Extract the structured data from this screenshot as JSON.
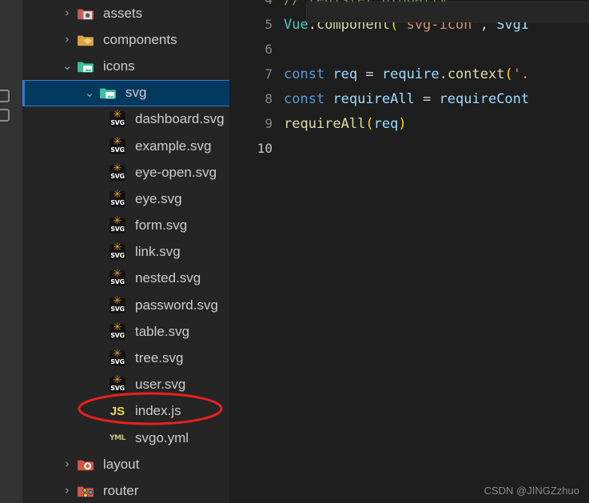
{
  "activity_bar": {
    "icons": [
      "chevron-right-icon",
      "square-outline-icon",
      "square-outline-icon"
    ]
  },
  "explorer": {
    "items": [
      {
        "label": "assets",
        "type": "folder",
        "icon": "folder-assets-icon",
        "twisty": "›",
        "indent": 1,
        "selected": false
      },
      {
        "label": "components",
        "type": "folder",
        "icon": "folder-components-icon",
        "twisty": "›",
        "indent": 1,
        "selected": false
      },
      {
        "label": "icons",
        "type": "folder",
        "icon": "folder-icons-open-icon",
        "twisty": "⌄",
        "indent": 1,
        "selected": false
      },
      {
        "label": "svg",
        "type": "folder",
        "icon": "folder-svg-open-icon",
        "twisty": "⌄",
        "indent": 2,
        "selected": true
      },
      {
        "label": "dashboard.svg",
        "type": "svg",
        "icon": "svg-file-icon",
        "twisty": "",
        "indent": 3,
        "selected": false
      },
      {
        "label": "example.svg",
        "type": "svg",
        "icon": "svg-file-icon",
        "twisty": "",
        "indent": 3,
        "selected": false
      },
      {
        "label": "eye-open.svg",
        "type": "svg",
        "icon": "svg-file-icon",
        "twisty": "",
        "indent": 3,
        "selected": false
      },
      {
        "label": "eye.svg",
        "type": "svg",
        "icon": "svg-file-icon",
        "twisty": "",
        "indent": 3,
        "selected": false
      },
      {
        "label": "form.svg",
        "type": "svg",
        "icon": "svg-file-icon",
        "twisty": "",
        "indent": 3,
        "selected": false
      },
      {
        "label": "link.svg",
        "type": "svg",
        "icon": "svg-file-icon",
        "twisty": "",
        "indent": 3,
        "selected": false
      },
      {
        "label": "nested.svg",
        "type": "svg",
        "icon": "svg-file-icon",
        "twisty": "",
        "indent": 3,
        "selected": false
      },
      {
        "label": "password.svg",
        "type": "svg",
        "icon": "svg-file-icon",
        "twisty": "",
        "indent": 3,
        "selected": false
      },
      {
        "label": "table.svg",
        "type": "svg",
        "icon": "svg-file-icon",
        "twisty": "",
        "indent": 3,
        "selected": false
      },
      {
        "label": "tree.svg",
        "type": "svg",
        "icon": "svg-file-icon",
        "twisty": "",
        "indent": 3,
        "selected": false
      },
      {
        "label": "user.svg",
        "type": "svg",
        "icon": "svg-file-icon",
        "twisty": "",
        "indent": 3,
        "selected": false
      },
      {
        "label": "index.js",
        "type": "js",
        "icon": "js-file-icon",
        "twisty": "",
        "indent": 3,
        "selected": false
      },
      {
        "label": "svgo.yml",
        "type": "yml",
        "icon": "yml-file-icon",
        "twisty": "",
        "indent": 3,
        "selected": false
      },
      {
        "label": "layout",
        "type": "folder",
        "icon": "folder-layout-icon",
        "twisty": "›",
        "indent": 1,
        "selected": false
      },
      {
        "label": "router",
        "type": "folder",
        "icon": "folder-router-icon",
        "twisty": "›",
        "indent": 1,
        "selected": false
      }
    ],
    "js_icon_text": "JS",
    "yml_icon_text": "YML",
    "svg_icon_text": "SVG"
  },
  "annotation": {
    "shape": "red-ellipse",
    "target": "index.js",
    "color": "#e8201f"
  },
  "editor": {
    "lines": [
      {
        "number": "4",
        "tokens": [
          {
            "t": "// register globally",
            "c": "t-comment"
          }
        ]
      },
      {
        "number": "5",
        "tokens": [
          {
            "t": "Vue",
            "c": "t-class"
          },
          {
            "t": ".",
            "c": "t-plain"
          },
          {
            "t": "component",
            "c": "t-fn"
          },
          {
            "t": "(",
            "c": "t-p1"
          },
          {
            "t": "'svg-icon'",
            "c": "t-str"
          },
          {
            "t": ",",
            "c": "t-plain"
          },
          {
            "t": " SvgI",
            "c": "t-var"
          }
        ]
      },
      {
        "number": "6",
        "tokens": []
      },
      {
        "number": "7",
        "tokens": [
          {
            "t": "const",
            "c": "t-kw"
          },
          {
            "t": " ",
            "c": "t-plain"
          },
          {
            "t": "req",
            "c": "t-var"
          },
          {
            "t": " ",
            "c": "t-plain"
          },
          {
            "t": "=",
            "c": "t-plain"
          },
          {
            "t": " ",
            "c": "t-plain"
          },
          {
            "t": "require",
            "c": "t-var"
          },
          {
            "t": ".",
            "c": "t-plain"
          },
          {
            "t": "context",
            "c": "t-fn"
          },
          {
            "t": "(",
            "c": "t-p1"
          },
          {
            "t": "'.",
            "c": "t-str"
          }
        ]
      },
      {
        "number": "8",
        "tokens": [
          {
            "t": "const",
            "c": "t-kw"
          },
          {
            "t": " ",
            "c": "t-plain"
          },
          {
            "t": "requireAll",
            "c": "t-var"
          },
          {
            "t": " ",
            "c": "t-plain"
          },
          {
            "t": "=",
            "c": "t-plain"
          },
          {
            "t": " ",
            "c": "t-plain"
          },
          {
            "t": "requireCont",
            "c": "t-var"
          }
        ]
      },
      {
        "number": "9",
        "tokens": [
          {
            "t": "requireAll",
            "c": "t-fn"
          },
          {
            "t": "(",
            "c": "t-p1"
          },
          {
            "t": "req",
            "c": "t-var"
          },
          {
            "t": ")",
            "c": "t-p1"
          }
        ]
      },
      {
        "number": "10",
        "tokens": [],
        "cursor": true
      }
    ]
  },
  "watermark": {
    "text": "CSDN @JINGZzhuo"
  }
}
